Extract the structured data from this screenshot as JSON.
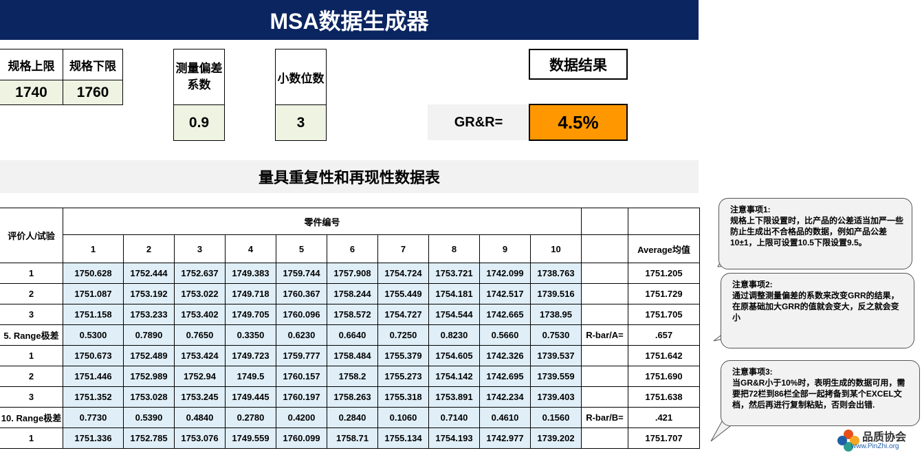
{
  "title": "MSA数据生成器",
  "spec": {
    "upper_label": "规格上限",
    "lower_label": "规格下限",
    "upper_value": "1740",
    "lower_value": "1760",
    "bias_label_1": "测量偏差",
    "bias_label_2": "系数",
    "bias_value": "0.9",
    "decimals_label": "小数位数",
    "decimals_value": "3"
  },
  "result": {
    "label": "数据结果",
    "grr_label": "GR&R=",
    "grr_value": "4.5%"
  },
  "table_title": "量具重复性和再现性数据表",
  "table": {
    "row_header": "评价人/试验",
    "parts_header": "零件编号",
    "average_header": "Average均值",
    "part_numbers": [
      "1",
      "2",
      "3",
      "4",
      "5",
      "6",
      "7",
      "8",
      "9",
      "10"
    ],
    "rows": [
      {
        "label": "1",
        "values": [
          "1750.628",
          "1752.444",
          "1752.637",
          "1749.383",
          "1759.744",
          "1757.908",
          "1754.724",
          "1753.721",
          "1742.099",
          "1738.763"
        ],
        "extra": "",
        "avg": "1751.205"
      },
      {
        "label": "2",
        "values": [
          "1751.087",
          "1753.192",
          "1753.022",
          "1749.718",
          "1760.367",
          "1758.244",
          "1755.449",
          "1754.181",
          "1742.517",
          "1739.516"
        ],
        "extra": "",
        "avg": "1751.729"
      },
      {
        "label": "3",
        "values": [
          "1751.158",
          "1753.233",
          "1753.402",
          "1749.705",
          "1760.096",
          "1758.572",
          "1754.727",
          "1754.544",
          "1742.665",
          "1738.95"
        ],
        "extra": "",
        "avg": "1751.705"
      },
      {
        "label": "5. Range极差",
        "values": [
          "0.5300",
          "0.7890",
          "0.7650",
          "0.3350",
          "0.6230",
          "0.6640",
          "0.7250",
          "0.8230",
          "0.5660",
          "0.7530"
        ],
        "extra": "R-bar/A=",
        "avg": ".657"
      },
      {
        "label": "1",
        "values": [
          "1750.673",
          "1752.489",
          "1753.424",
          "1749.723",
          "1759.777",
          "1758.484",
          "1755.379",
          "1754.605",
          "1742.326",
          "1739.537"
        ],
        "extra": "",
        "avg": "1751.642"
      },
      {
        "label": "2",
        "values": [
          "1751.446",
          "1752.989",
          "1752.94",
          "1749.5",
          "1760.157",
          "1758.2",
          "1755.273",
          "1754.142",
          "1742.695",
          "1739.559"
        ],
        "extra": "",
        "avg": "1751.690"
      },
      {
        "label": "3",
        "values": [
          "1751.352",
          "1753.028",
          "1753.245",
          "1749.445",
          "1760.197",
          "1758.263",
          "1755.318",
          "1753.891",
          "1742.234",
          "1739.403"
        ],
        "extra": "",
        "avg": "1751.638"
      },
      {
        "label": "10. Range极差",
        "values": [
          "0.7730",
          "0.5390",
          "0.4840",
          "0.2780",
          "0.4200",
          "0.2840",
          "0.1060",
          "0.7140",
          "0.4610",
          "0.1560"
        ],
        "extra": "R-bar/B=",
        "avg": ".421"
      },
      {
        "label": "1",
        "values": [
          "1751.336",
          "1752.785",
          "1753.076",
          "1749.559",
          "1760.099",
          "1758.71",
          "1755.134",
          "1754.193",
          "1742.977",
          "1739.202"
        ],
        "extra": "",
        "avg": "1751.707"
      }
    ]
  },
  "notes": [
    {
      "title": "注意事项1:",
      "body": "规格上下限设置时，比产品的公差适当加严一些防止生成出不合格品的数据，例如产品公差10±1，上限可设置10.5下限设置9.5。"
    },
    {
      "title": "注意事项2:",
      "body": "通过调整测量偏差的系数来改变GRR的结果，在原基础加大GRR的值就会变大，反之就会变小"
    },
    {
      "title": "注意事项3:",
      "body": "当GR&R小于10%时，表明生成的数据可用，需要把72栏到86栏全部一起拷备到某个EXCEL文档，然后再进行复制粘贴，否则会出错."
    }
  ],
  "logo": {
    "name": "品质协会",
    "url": "www.PinZhi.org"
  },
  "colors": {
    "title_bg": "#0b2561",
    "grr_bg": "#ff9800",
    "data_bg": "#dfeef7",
    "input_bg": "#eef3e2"
  }
}
